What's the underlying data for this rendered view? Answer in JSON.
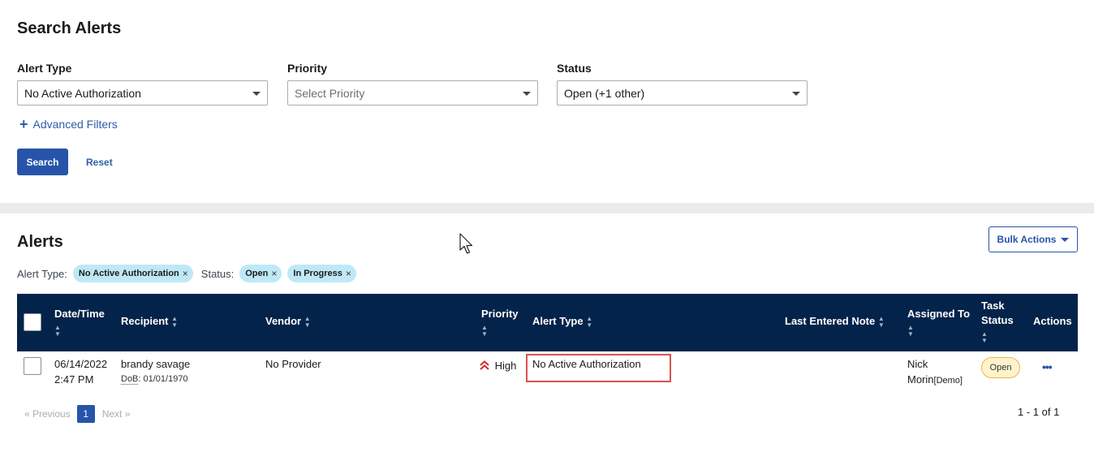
{
  "search": {
    "title": "Search Alerts",
    "alert_type": {
      "label": "Alert Type",
      "value": "No Active Authorization"
    },
    "priority": {
      "label": "Priority",
      "placeholder": "Select Priority"
    },
    "status": {
      "label": "Status",
      "value": "Open (+1 other)"
    },
    "advanced_filters": "Advanced Filters",
    "search_button": "Search",
    "reset_button": "Reset"
  },
  "alerts": {
    "title": "Alerts",
    "bulk_actions": "Bulk Actions",
    "filters": {
      "alert_type_label": "Alert Type:",
      "alert_type_chip": "No Active Authorization",
      "status_label": "Status:",
      "status_chips": [
        "Open",
        "In Progress"
      ],
      "remove_glyph": "×"
    },
    "columns": {
      "datetime": "Date/Time",
      "recipient": "Recipient",
      "vendor": "Vendor",
      "priority": "Priority",
      "alert_type": "Alert Type",
      "last_note": "Last Entered Note",
      "assigned_to": "Assigned To",
      "task_status_1": "Task",
      "task_status_2": "Status",
      "actions": "Actions"
    },
    "rows": [
      {
        "date": "06/14/2022",
        "time": "2:47 PM",
        "recipient": "brandy savage",
        "dob_label": "DoB",
        "dob_value": ": 01/01/1970",
        "vendor": "No Provider",
        "priority": "High",
        "alert_type": "No Active Authorization",
        "last_note": "",
        "assigned_first": "Nick",
        "assigned_last": "Morin",
        "assigned_tag": "[Demo]",
        "task_status": "Open",
        "actions": "•••"
      }
    ],
    "pagination": {
      "prev": "« Previous",
      "page": "1",
      "next": "Next »",
      "range": "1 - 1 of 1"
    }
  },
  "colors": {
    "header_bg": "#04234a",
    "primary": "#2754a8",
    "chip_bg": "#bfe8f7",
    "high_priority": "#d22a2a",
    "highlight": "#d9534f"
  }
}
